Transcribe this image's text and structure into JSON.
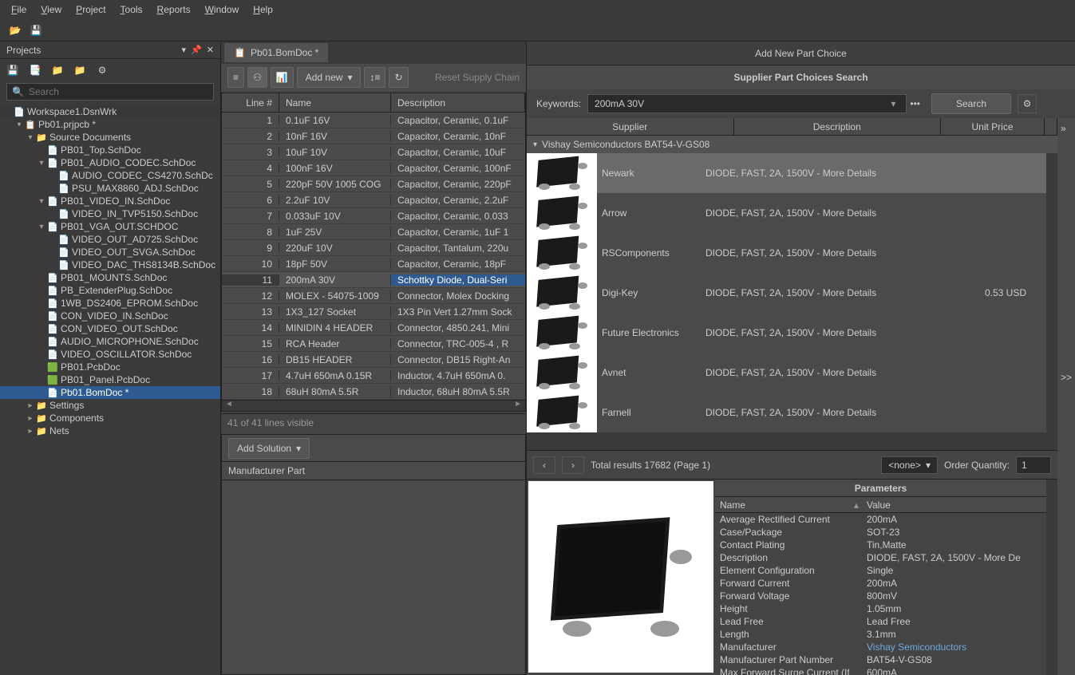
{
  "menu": [
    "File",
    "View",
    "Project",
    "Tools",
    "Reports",
    "Window",
    "Help"
  ],
  "projects_panel": {
    "title": "Projects",
    "search_placeholder": "Search"
  },
  "tree": [
    {
      "d": 0,
      "exp": "",
      "ico": "📄",
      "label": "Workspace1.DsnWrk",
      "sel": false,
      "bg": "#383838"
    },
    {
      "d": 1,
      "exp": "▾",
      "ico": "📋",
      "label": "Pb01.prjpcb *",
      "sel": false
    },
    {
      "d": 2,
      "exp": "▾",
      "ico": "📁",
      "label": "Source Documents"
    },
    {
      "d": 3,
      "exp": "",
      "ico": "📄",
      "label": "PB01_Top.SchDoc"
    },
    {
      "d": 3,
      "exp": "▾",
      "ico": "📄",
      "label": "PB01_AUDIO_CODEC.SchDoc"
    },
    {
      "d": 4,
      "exp": "",
      "ico": "📄",
      "label": "AUDIO_CODEC_CS4270.SchDc"
    },
    {
      "d": 4,
      "exp": "",
      "ico": "📄",
      "label": "PSU_MAX8860_ADJ.SchDoc"
    },
    {
      "d": 3,
      "exp": "▾",
      "ico": "📄",
      "label": "PB01_VIDEO_IN.SchDoc"
    },
    {
      "d": 4,
      "exp": "",
      "ico": "📄",
      "label": "VIDEO_IN_TVP5150.SchDoc"
    },
    {
      "d": 3,
      "exp": "▾",
      "ico": "📄",
      "label": "PB01_VGA_OUT.SCHDOC"
    },
    {
      "d": 4,
      "exp": "",
      "ico": "📄",
      "label": "VIDEO_OUT_AD725.SchDoc"
    },
    {
      "d": 4,
      "exp": "",
      "ico": "📄",
      "label": "VIDEO_OUT_SVGA.SchDoc"
    },
    {
      "d": 4,
      "exp": "",
      "ico": "📄",
      "label": "VIDEO_DAC_THS8134B.SchDoc"
    },
    {
      "d": 3,
      "exp": "",
      "ico": "📄",
      "label": "PB01_MOUNTS.SchDoc"
    },
    {
      "d": 3,
      "exp": "",
      "ico": "📄",
      "label": "PB_ExtenderPlug.SchDoc"
    },
    {
      "d": 3,
      "exp": "",
      "ico": "📄",
      "label": "1WB_DS2406_EPROM.SchDoc"
    },
    {
      "d": 3,
      "exp": "",
      "ico": "📄",
      "label": "CON_VIDEO_IN.SchDoc"
    },
    {
      "d": 3,
      "exp": "",
      "ico": "📄",
      "label": "CON_VIDEO_OUT.SchDoc"
    },
    {
      "d": 3,
      "exp": "",
      "ico": "📄",
      "label": "AUDIO_MICROPHONE.SchDoc"
    },
    {
      "d": 3,
      "exp": "",
      "ico": "📄",
      "label": "VIDEO_OSCILLATOR.SchDoc"
    },
    {
      "d": 3,
      "exp": "",
      "ico": "🟩",
      "label": "PB01.PcbDoc"
    },
    {
      "d": 3,
      "exp": "",
      "ico": "🟩",
      "label": "PB01_Panel.PcbDoc"
    },
    {
      "d": 3,
      "exp": "",
      "ico": "📄",
      "label": "Pb01.BomDoc *",
      "sel": true
    },
    {
      "d": 2,
      "exp": "▸",
      "ico": "📁",
      "label": "Settings"
    },
    {
      "d": 2,
      "exp": "▸",
      "ico": "📁",
      "label": "Components"
    },
    {
      "d": 2,
      "exp": "▸",
      "ico": "📁",
      "label": "Nets"
    }
  ],
  "document_tab": "Pb01.BomDoc *",
  "bom_toolbar": {
    "add_new": "Add new",
    "reset": "Reset Supply Chain"
  },
  "bom_columns": [
    "Line #",
    "Name",
    "Description"
  ],
  "bom_rows": [
    {
      "n": 1,
      "name": "0.1uF 16V",
      "desc": "Capacitor, Ceramic, 0.1uF"
    },
    {
      "n": 2,
      "name": "10nF 16V",
      "desc": "Capacitor, Ceramic, 10nF"
    },
    {
      "n": 3,
      "name": "10uF 10V",
      "desc": "Capacitor, Ceramic, 10uF"
    },
    {
      "n": 4,
      "name": "100nF 16V",
      "desc": "Capacitor, Ceramic, 100nF"
    },
    {
      "n": 5,
      "name": "220pF 50V 1005 COG",
      "desc": "Capacitor, Ceramic, 220pF"
    },
    {
      "n": 6,
      "name": "2.2uF 10V",
      "desc": "Capacitor, Ceramic, 2.2uF"
    },
    {
      "n": 7,
      "name": "0.033uF 10V",
      "desc": "Capacitor, Ceramic, 0.033"
    },
    {
      "n": 8,
      "name": "1uF 25V",
      "desc": "Capacitor, Ceramic, 1uF 1"
    },
    {
      "n": 9,
      "name": "220uF 10V",
      "desc": "Capacitor, Tantalum, 220u"
    },
    {
      "n": 10,
      "name": "18pF 50V",
      "desc": "Capacitor, Ceramic, 18pF"
    },
    {
      "n": 11,
      "name": "200mA 30V",
      "desc": "Schottky Diode, Dual-Seri",
      "sel": true
    },
    {
      "n": 12,
      "name": "MOLEX - 54075-1009",
      "desc": "Connector, Molex Docking"
    },
    {
      "n": 13,
      "name": "1X3_127 Socket",
      "desc": "1X3 Pin Vert 1.27mm Sock"
    },
    {
      "n": 14,
      "name": "MINIDIN 4 HEADER",
      "desc": "Connector, 4850.241, Mini"
    },
    {
      "n": 15,
      "name": "RCA Header",
      "desc": "Connector, TRC-005-4 , R"
    },
    {
      "n": 16,
      "name": "DB15 HEADER",
      "desc": "Connector, DB15 Right-An"
    },
    {
      "n": 17,
      "name": "4.7uH 650mA 0.15R",
      "desc": "Inductor, 4.7uH 650mA 0."
    },
    {
      "n": 18,
      "name": "68uH 80mA 5.5R",
      "desc": "Inductor, 68uH 80mA 5.5R"
    }
  ],
  "bom_footer": "41 of 41 lines visible",
  "add_solution": "Add Solution",
  "mfr_col": "Manufacturer Part",
  "right": {
    "title": "Add New Part Choice",
    "subtitle": "Supplier Part Choices Search",
    "kw_label": "Keywords:",
    "kw_value": "200mA 30V",
    "search_btn": "Search",
    "cols": [
      "Supplier",
      "Description",
      "Unit Price"
    ],
    "group": "Vishay Semiconductors BAT54-V-GS08",
    "suppliers": [
      {
        "name": "Newark",
        "desc": "DIODE, FAST, 2A, 1500V - More Details",
        "price": "",
        "sel": true
      },
      {
        "name": "Arrow",
        "desc": "DIODE, FAST, 2A, 1500V - More Details",
        "price": ""
      },
      {
        "name": "RSComponents",
        "desc": "DIODE, FAST, 2A, 1500V - More Details",
        "price": ""
      },
      {
        "name": "Digi-Key",
        "desc": "DIODE, FAST, 2A, 1500V - More Details",
        "price": "0.53 USD"
      },
      {
        "name": "Future Electronics",
        "desc": "DIODE, FAST, 2A, 1500V - More Details",
        "price": ""
      },
      {
        "name": "Avnet",
        "desc": "DIODE, FAST, 2A, 1500V - More Details",
        "price": ""
      },
      {
        "name": "Farnell",
        "desc": "DIODE, FAST, 2A, 1500V - More Details",
        "price": ""
      }
    ],
    "pager": {
      "total": "Total results 17682 (Page 1)",
      "none": "<none>",
      "order_label": "Order Quantity:",
      "order_value": "1"
    },
    "params_title": "Parameters",
    "params_cols": [
      "Name",
      "Value"
    ],
    "params": [
      {
        "n": "Average Rectified Current",
        "v": "200mA"
      },
      {
        "n": "Case/Package",
        "v": "SOT-23"
      },
      {
        "n": "Contact Plating",
        "v": "Tin,Matte"
      },
      {
        "n": "Description",
        "v": "DIODE, FAST, 2A, 1500V - More De"
      },
      {
        "n": "Element Configuration",
        "v": "Single"
      },
      {
        "n": "Forward Current",
        "v": "200mA"
      },
      {
        "n": "Forward Voltage",
        "v": "800mV"
      },
      {
        "n": "Height",
        "v": "1.05mm"
      },
      {
        "n": "Lead Free",
        "v": "Lead Free"
      },
      {
        "n": "Length",
        "v": "3.1mm"
      },
      {
        "n": "Manufacturer",
        "v": "Vishay Semiconductors",
        "link": true
      },
      {
        "n": "Manufacturer Part Number",
        "v": "BAT54-V-GS08"
      },
      {
        "n": "Max Forward Surge Current (Ifsm",
        "v": "600mA"
      }
    ]
  }
}
